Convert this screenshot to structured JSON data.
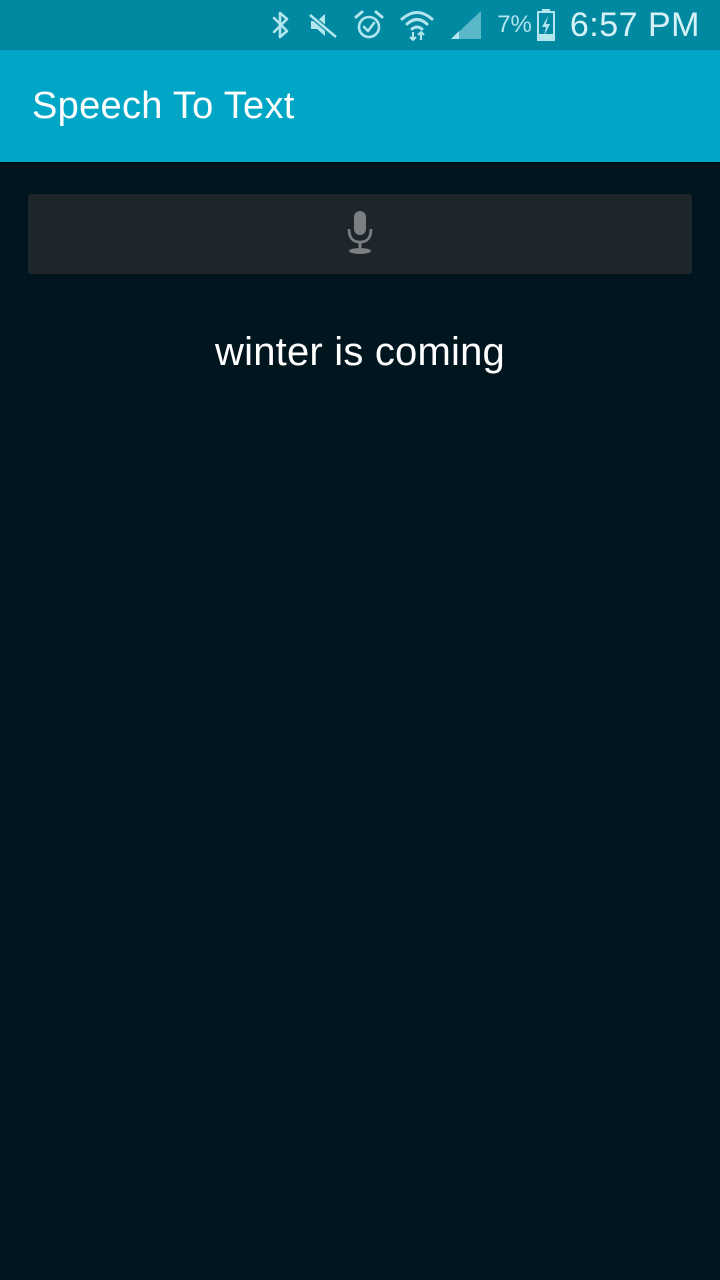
{
  "status_bar": {
    "icons": [
      "bluetooth-icon",
      "mute-icon",
      "alarm-icon",
      "wifi-icon",
      "signal-icon",
      "battery-icon"
    ],
    "battery_percent": "7%",
    "time": "6:57 PM",
    "colors": {
      "background": "#0289a2",
      "icon": "#b3e5ee"
    }
  },
  "app_bar": {
    "title": "Speech To Text",
    "color": "#00a6c5"
  },
  "main": {
    "mic_button": {
      "icon": "microphone-icon",
      "background": "#1f262b"
    },
    "recognized_text": "winter is coming",
    "background": "#00151e"
  }
}
